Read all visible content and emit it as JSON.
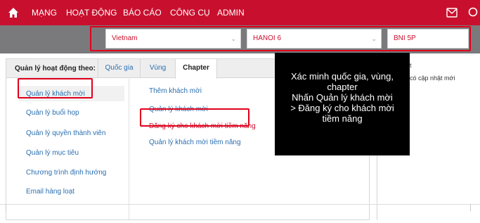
{
  "nav": {
    "items": [
      "MẠNG",
      "HOẠT ĐỘNG",
      "BÁO CÁO",
      "CÔNG CỤ",
      "ADMIN"
    ],
    "home_icon": "home-icon",
    "mail_icon": "mail-icon",
    "search_icon": "search-icon"
  },
  "filters": {
    "country": "Vietnam",
    "region": "HANOI 6",
    "chapter": "BNI 5P"
  },
  "panel": {
    "manage_by_label": "Quản lý hoạt động theo:",
    "tabs": [
      "Quốc gia",
      "Vùng",
      "Chapter"
    ],
    "active_tab": "Chapter",
    "left_menu": [
      "Quản lý khách mời",
      "Quản lý buổi họp",
      "Quản lý quyền thành viên",
      "Quản lý mục tiêu",
      "Chương trình định hướng",
      "Email hàng loạt"
    ],
    "right_menu": [
      "Thêm khách mời",
      "Quản lý khách mời",
      "Đăng ký cho khách mời tiềm năng",
      "Quản lý khách mời tiềm năng"
    ]
  },
  "side": {
    "line1": "t",
    "line2": "có cập nhật mới"
  },
  "overlay": {
    "lines": [
      "Xác minh quốc gia, vùng,",
      "chapter",
      "Nhấn Quản lý khách mời",
      "> Đăng ký cho khách mời",
      "tiềm năng"
    ]
  },
  "colors": {
    "brand_red": "#c8102e",
    "highlight_red": "#e0001b",
    "link_blue": "#2a6fb0",
    "filter_bar": "#7a7a7d"
  }
}
